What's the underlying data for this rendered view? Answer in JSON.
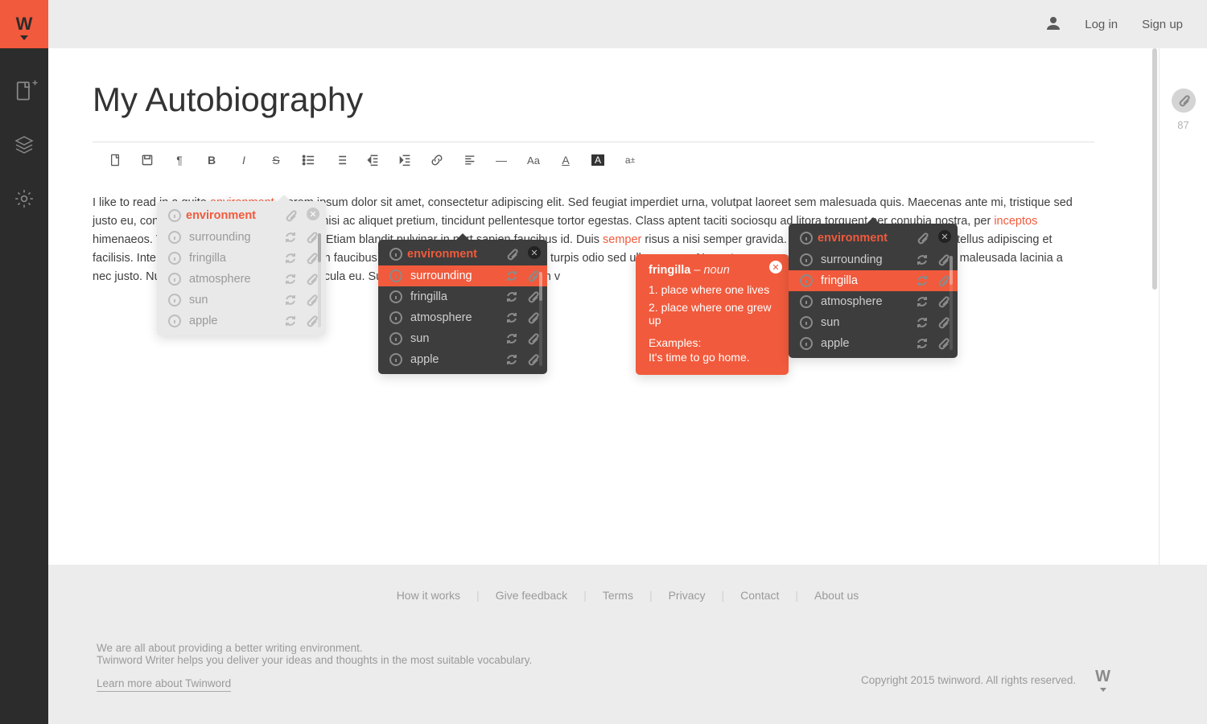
{
  "brand": "W",
  "header": {
    "login": "Log in",
    "signup": "Sign up"
  },
  "right_rail": {
    "attachment_count": "87"
  },
  "doc": {
    "title": "My Autobiography",
    "para": {
      "p0": "I like to read in a quite ",
      "kw0": "environment",
      "p1": ". Lorem ipsum dolor sit amet, consectetur adipiscing elit. Sed feugiat imperdiet urna, volutpat laoreet sem malesuada quis. Maecenas ante mi, tristique sed justo eu, consectetur semper erci. Ut lacinia nisi ac aliquet pretium, tincidunt pellentesque tortor egestas. Class aptent taciti sociosqu ad litora torquent per conubia nostra, per ",
      "kw1": "inceptos",
      "p2": " himenaeos. Vivamus sit amet tincidunt justo. Etiam  blandit pulvinar in port sapien faucibus id. Duis ",
      "kw2": "semper",
      "p3": " risus a nisi semper gravida. Nam eu eros laoreet, commodo tellus adipiscing et facilisis. Interda fames ac ante ipsum primis in faucibus sodales augue quis aurk. Donec turpis odio sed ullamcorper. Nam et arcu eu metus congue dapibus et faucibus maleusada lacinia a nec justo. Nulla scelerisque. Donec quis vehicula eu. Sus vitae. Augue molestie lorem. In v"
    }
  },
  "popover": {
    "header_word": "environment",
    "options": {
      "surrounding": "surrounding",
      "fringilla": "fringilla",
      "atmosphere": "atmosphere",
      "sun": "sun",
      "apple": "apple"
    }
  },
  "tooltip": {
    "word": "fringilla",
    "pos": " – noun",
    "d1": "1. place where one lives",
    "d2": "2. place where one grew up",
    "exh": "Examples:",
    "ex": "It's time to go home."
  },
  "footer": {
    "links": {
      "how": "How it works",
      "feedback": "Give feedback",
      "terms": "Terms",
      "privacy": "Privacy",
      "contact": "Contact",
      "about": "About us"
    },
    "blurb1": "We are all about providing a better writing environment.",
    "blurb2": "Twinword Writer helps you deliver your ideas and thoughts in the most suitable vocabulary.",
    "learn": "Learn more about Twinword",
    "copyright": "Copyright 2015 twinword. All rights reserved."
  }
}
